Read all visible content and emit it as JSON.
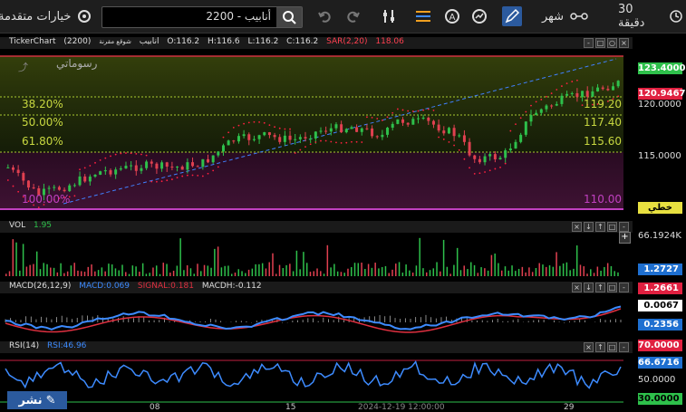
{
  "toolbar": {
    "timeframe": "30 دقيقة",
    "period": "شهر",
    "search_value": "2200 - أنابيب",
    "advanced_options": "خيارات متقدمة"
  },
  "main_pane": {
    "ticker_label": "TickerChart",
    "symbol": "(2200)",
    "name": "أنابيب",
    "name_sub": "شوقع مقرنة",
    "open": "O:116.2",
    "high": "H:116.6",
    "low": "L:116.2",
    "close": "C:116.2",
    "sar": "SAR(2,20)",
    "sar_value": "118.06",
    "watermark": "رسوماتي",
    "fib": {
      "f382": "38.20%",
      "f500": "50.00%",
      "f618": "61.80%",
      "f100": "100.00%",
      "v382": "119.20",
      "v500": "117.40",
      "v618": "115.60",
      "v100": "110.00"
    },
    "axis_labels": [
      "120.0000",
      "115.0000"
    ],
    "price_tag": "123.4000",
    "sar_tag": "120.9467",
    "line_tag": "خطي"
  },
  "vol_pane": {
    "label": "VOL",
    "value": "1.95",
    "axis_top": "66.1924K",
    "tag": "1.2727"
  },
  "macd_pane": {
    "label": "MACD(26,12,9)",
    "macd": "MACD:0.069",
    "signal": "SIGNAL:0.181",
    "macdh": "MACDH:-0.112",
    "tag_red": "1.2661",
    "tag_blue": "0.2356",
    "tag_white": "0.0067"
  },
  "rsi_pane": {
    "label": "RSI(14)",
    "value": "RSI:46.96",
    "tag_upper": "70.0000",
    "tag_val": "66.6716",
    "axis_mid": "50.0000",
    "tag_lower": "30.0000"
  },
  "x_axis": {
    "labels": [
      "08",
      "15",
      "2024-12-19 12:00:00",
      "29"
    ]
  },
  "publish_label": "نشر",
  "colors": {
    "up": "#2ec04b",
    "down": "#e04050",
    "sar": "#ff2040",
    "macd": "#3d8bff",
    "signal": "#e03040",
    "rsi": "#3d8bff",
    "fib_zone_top": "#6b7a20",
    "fib_zone_bottom": "#5a1a3a"
  }
}
